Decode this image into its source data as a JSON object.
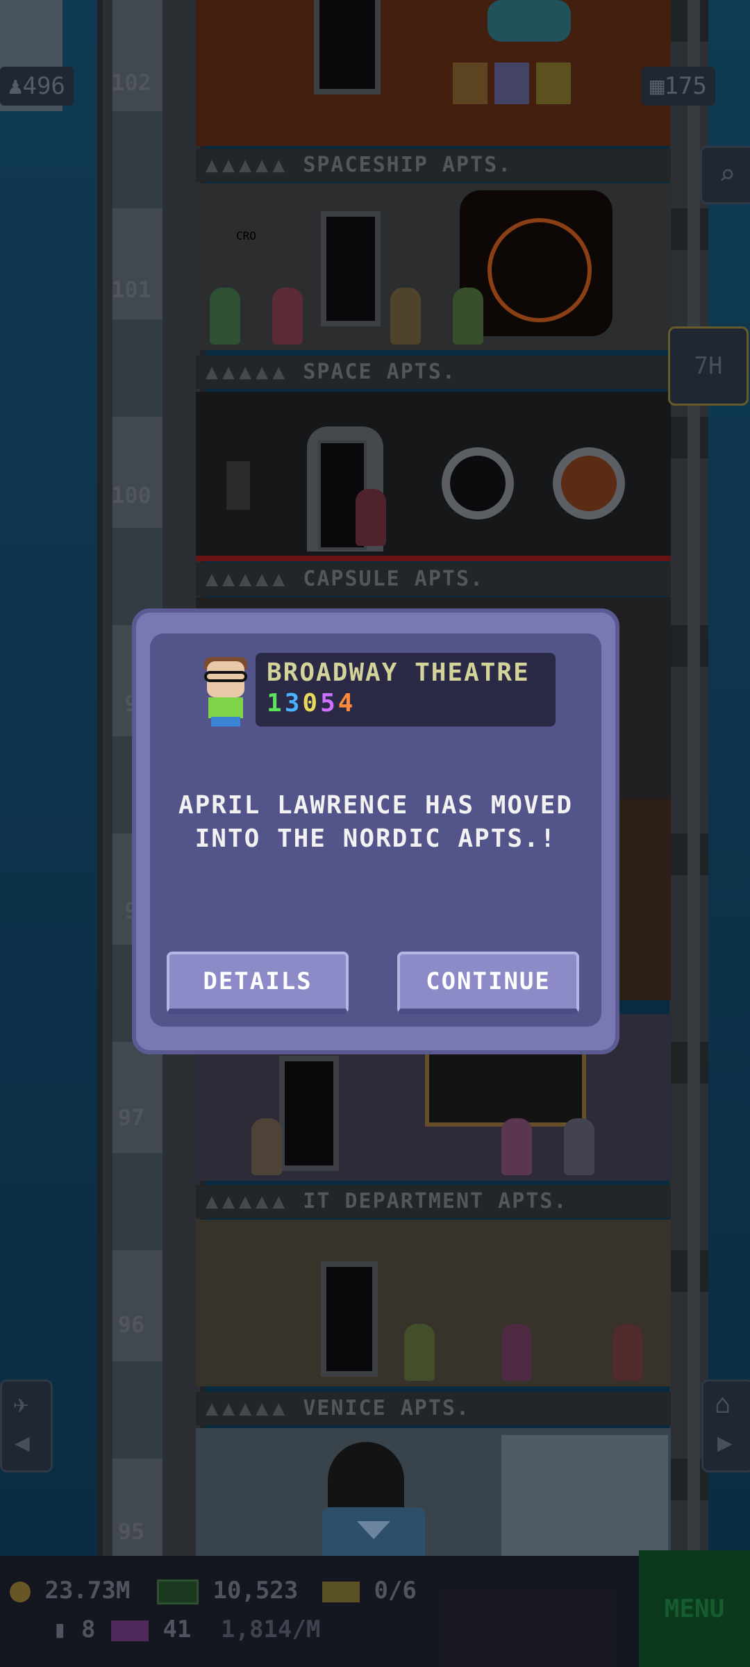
{
  "hud": {
    "population": "496",
    "floor_count": "175",
    "timer": "7H"
  },
  "floors": [
    {
      "number": "102",
      "label": "SPACESHIP APTS."
    },
    {
      "number": "101",
      "label": "SPACE APTS."
    },
    {
      "number": "100",
      "label": "CAPSULE APTS."
    },
    {
      "number": "9",
      "label": ""
    },
    {
      "number": "9",
      "label": ""
    },
    {
      "number": "97",
      "label": "IT DEPARTMENT APTS."
    },
    {
      "number": "96",
      "label": "VENICE APTS."
    },
    {
      "number": "95",
      "label": ""
    }
  ],
  "room_sign": "CRO",
  "dialog": {
    "venue_name": "BROADWAY THEATRE",
    "venue_digits": [
      "1",
      "3",
      "0",
      "5",
      "4"
    ],
    "digit_colors": [
      "#5be35b",
      "#4ab2ff",
      "#e8d95a",
      "#d070ff",
      "#ff8a3a"
    ],
    "message_line1": "APRIL LAWRENCE HAS MOVED",
    "message_line2": "INTO THE NORDIC APTS.!",
    "details_label": "DETAILS",
    "continue_label": "CONTINUE"
  },
  "bottom": {
    "coins": "23.73M",
    "bux": "10,523",
    "tickets": "0/6",
    "stat_a": "8",
    "stat_b": "41",
    "rate": "1,814/M",
    "menu_label": "MENU"
  }
}
